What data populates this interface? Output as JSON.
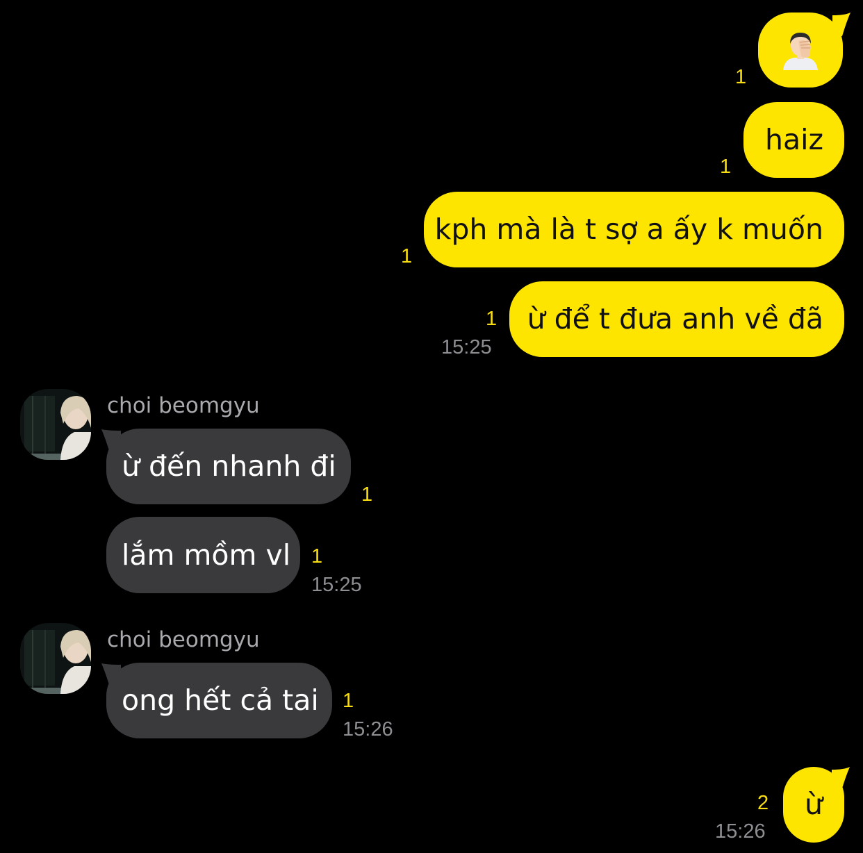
{
  "messages": {
    "m1": {
      "text": "",
      "icon": "face-palm-emoji-icon",
      "unread": "1"
    },
    "m2": {
      "text": "haiz",
      "unread": "1"
    },
    "m3": {
      "text": "kph mà là t sợ a ấy k muốn",
      "unread": "1"
    },
    "m4": {
      "text": "ừ để t đưa anh về đã",
      "unread": "1",
      "time": "15:25"
    },
    "m5": {
      "sender": "choi beomgyu",
      "text": "ừ đến nhanh đi",
      "unread": "1"
    },
    "m6": {
      "text": "lắm mồm vl",
      "unread": "1",
      "time": "15:25"
    },
    "m7": {
      "sender": "choi beomgyu",
      "text": "ong hết cả tai",
      "unread": "1",
      "time": "15:26"
    },
    "m8": {
      "text": "ừ",
      "unread": "2",
      "time": "15:26"
    }
  },
  "colors": {
    "background": "#000000",
    "my_bubble": "#FEE500",
    "their_bubble": "#3A3A3C",
    "unread_count": "#F7DD12",
    "timestamp": "#8E8E93"
  }
}
